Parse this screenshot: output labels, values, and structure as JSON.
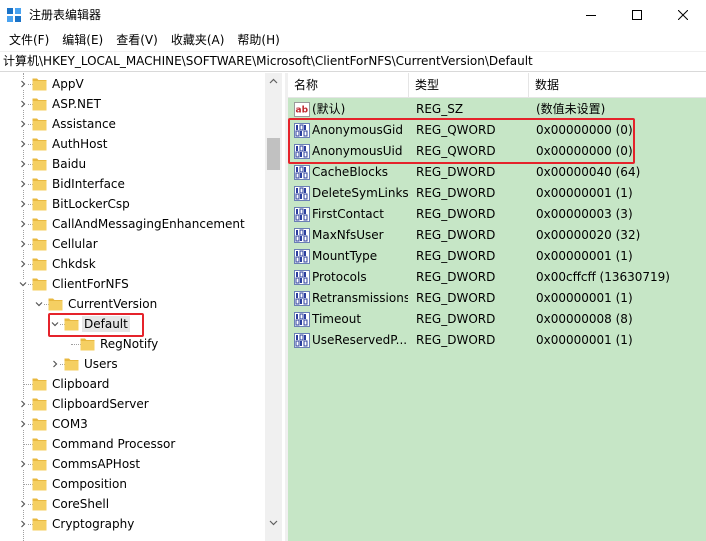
{
  "window": {
    "title": "注册表编辑器",
    "accent": "#1a73c8"
  },
  "menu": [
    "文件(F)",
    "编辑(E)",
    "查看(V)",
    "收藏夹(A)",
    "帮助(H)"
  ],
  "address": "计算机\\HKEY_LOCAL_MACHINE\\SOFTWARE\\Microsoft\\ClientForNFS\\CurrentVersion\\Default",
  "tree": [
    {
      "label": "AppV",
      "depth": 0,
      "expander": "closed"
    },
    {
      "label": "ASP.NET",
      "depth": 0,
      "expander": "closed"
    },
    {
      "label": "Assistance",
      "depth": 0,
      "expander": "closed"
    },
    {
      "label": "AuthHost",
      "depth": 0,
      "expander": "closed"
    },
    {
      "label": "Baidu",
      "depth": 0,
      "expander": "closed"
    },
    {
      "label": "BidInterface",
      "depth": 0,
      "expander": "closed"
    },
    {
      "label": "BitLockerCsp",
      "depth": 0,
      "expander": "closed"
    },
    {
      "label": "CallAndMessagingEnhancement",
      "depth": 0,
      "expander": "closed"
    },
    {
      "label": "Cellular",
      "depth": 0,
      "expander": "closed"
    },
    {
      "label": "Chkdsk",
      "depth": 0,
      "expander": "closed"
    },
    {
      "label": "ClientForNFS",
      "depth": 0,
      "expander": "open"
    },
    {
      "label": "CurrentVersion",
      "depth": 1,
      "expander": "open"
    },
    {
      "label": "Default",
      "depth": 2,
      "expander": "open",
      "selected": true
    },
    {
      "label": "RegNotify",
      "depth": 3,
      "expander": "none"
    },
    {
      "label": "Users",
      "depth": 2,
      "expander": "closed"
    },
    {
      "label": "Clipboard",
      "depth": 0,
      "expander": "none"
    },
    {
      "label": "ClipboardServer",
      "depth": 0,
      "expander": "closed"
    },
    {
      "label": "COM3",
      "depth": 0,
      "expander": "closed"
    },
    {
      "label": "Command Processor",
      "depth": 0,
      "expander": "none"
    },
    {
      "label": "CommsAPHost",
      "depth": 0,
      "expander": "closed"
    },
    {
      "label": "Composition",
      "depth": 0,
      "expander": "none"
    },
    {
      "label": "CoreShell",
      "depth": 0,
      "expander": "closed"
    },
    {
      "label": "Cryptography",
      "depth": 0,
      "expander": "closed"
    }
  ],
  "columns": [
    "名称",
    "类型",
    "数据"
  ],
  "values": [
    {
      "name": "(默认)",
      "type": "REG_SZ",
      "data": "(数值未设置)",
      "icon": "string-value-icon"
    },
    {
      "name": "AnonymousGid",
      "type": "REG_QWORD",
      "data": "0x00000000 (0)",
      "icon": "binary-value-icon"
    },
    {
      "name": "AnonymousUid",
      "type": "REG_QWORD",
      "data": "0x00000000 (0)",
      "icon": "binary-value-icon"
    },
    {
      "name": "CacheBlocks",
      "type": "REG_DWORD",
      "data": "0x00000040 (64)",
      "icon": "binary-value-icon"
    },
    {
      "name": "DeleteSymLinks",
      "type": "REG_DWORD",
      "data": "0x00000001 (1)",
      "icon": "binary-value-icon"
    },
    {
      "name": "FirstContact",
      "type": "REG_DWORD",
      "data": "0x00000003 (3)",
      "icon": "binary-value-icon"
    },
    {
      "name": "MaxNfsUser",
      "type": "REG_DWORD",
      "data": "0x00000020 (32)",
      "icon": "binary-value-icon"
    },
    {
      "name": "MountType",
      "type": "REG_DWORD",
      "data": "0x00000001 (1)",
      "icon": "binary-value-icon"
    },
    {
      "name": "Protocols",
      "type": "REG_DWORD",
      "data": "0x00cffcff (13630719)",
      "icon": "binary-value-icon"
    },
    {
      "name": "Retransmissions",
      "type": "REG_DWORD",
      "data": "0x00000001 (1)",
      "icon": "binary-value-icon"
    },
    {
      "name": "Timeout",
      "type": "REG_DWORD",
      "data": "0x00000008 (8)",
      "icon": "binary-value-icon"
    },
    {
      "name": "UseReservedP...",
      "type": "REG_DWORD",
      "data": "0x00000001 (1)",
      "icon": "binary-value-icon"
    }
  ],
  "colors": {
    "list_background": "#c6e6c6",
    "highlight_box": "#e5232b",
    "folder": "#f5cf62"
  }
}
